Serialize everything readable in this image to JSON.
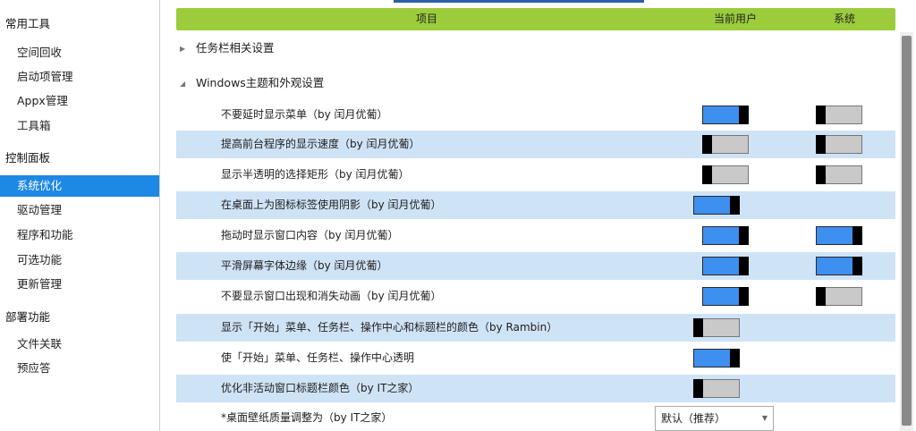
{
  "sidebar": {
    "groups": [
      {
        "title": "常用工具",
        "items": [
          "空间回收",
          "启动项管理",
          "Appx管理",
          "工具箱"
        ]
      },
      {
        "title": "控制面板",
        "items": [
          "系统优化",
          "驱动管理",
          "程序和功能",
          "可选功能",
          "更新管理"
        ]
      },
      {
        "title": "部署功能",
        "items": [
          "文件关联",
          "预应答"
        ]
      }
    ],
    "selected": "系统优化"
  },
  "header": {
    "col_item": "项目",
    "col_user": "当前用户",
    "col_system": "系统"
  },
  "sections": {
    "taskbar": "任务栏相关设置",
    "theme": "Windows主题和外观设置"
  },
  "rows": [
    {
      "label": "不要延时显示菜单（by 闰月优葡）",
      "user": "on",
      "system": "off"
    },
    {
      "label": "提高前台程序的显示速度（by 闰月优葡）",
      "user": "off",
      "system": "off"
    },
    {
      "label": "显示半透明的选择矩形（by 闰月优葡）",
      "user": "off",
      "system": "off"
    },
    {
      "label": "在桌面上为图标标签使用阴影（by 闰月优葡）",
      "single": "on"
    },
    {
      "label": "拖动时显示窗口内容（by 闰月优葡）",
      "user": "on",
      "system": "on"
    },
    {
      "label": "平滑屏幕字体边缘（by 闰月优葡）",
      "user": "on",
      "system": "on"
    },
    {
      "label": "不要显示窗口出现和消失动画（by 闰月优葡）",
      "user": "on",
      "system": "off"
    },
    {
      "label": "显示「开始」菜单、任务栏、操作中心和标题栏的颜色（by Rambin）",
      "single": "off"
    },
    {
      "label": "使「开始」菜单、任务栏、操作中心透明",
      "single": "on"
    },
    {
      "label": "优化非活动窗口标题栏颜色（by IT之家）",
      "single": "off"
    },
    {
      "label": "*桌面壁纸质量调整为（by IT之家）",
      "dropdown": "默认（推荐）"
    }
  ],
  "colors": {
    "header_bg": "#9ccc3c",
    "alt_row_bg": "#cfe3f6",
    "toggle_on": "#3d8ff0",
    "selected_nav": "#1e88e5"
  }
}
